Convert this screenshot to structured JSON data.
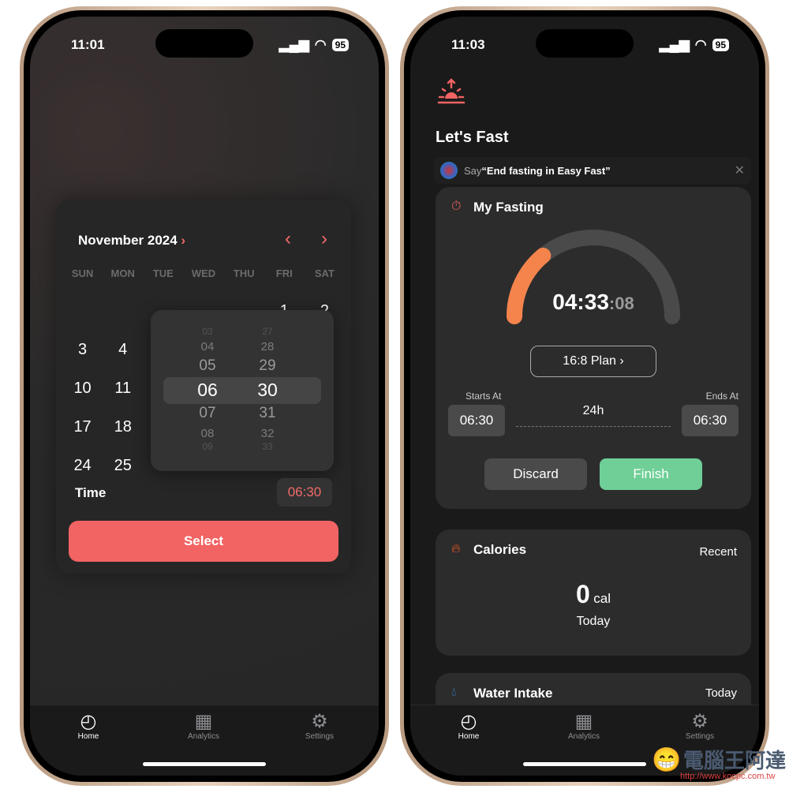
{
  "left_phone": {
    "status": {
      "time": "11:01",
      "battery": "95"
    },
    "calendar": {
      "month_label": "November 2024",
      "weekdays": [
        "SUN",
        "MON",
        "TUE",
        "WED",
        "THU",
        "FRI",
        "SAT"
      ],
      "rows": [
        [
          "",
          "",
          "",
          "",
          "",
          "1",
          "2"
        ],
        [
          "3",
          "4",
          "",
          "",
          "",
          "",
          ""
        ],
        [
          "10",
          "11",
          "",
          "",
          "",
          "",
          ""
        ],
        [
          "17",
          "18",
          "",
          "",
          "",
          "",
          ""
        ],
        [
          "24",
          "25",
          "",
          "",
          "",
          "",
          ""
        ]
      ]
    },
    "picker": {
      "hours": [
        "03",
        "04",
        "05",
        "06",
        "07",
        "08",
        "09"
      ],
      "minutes": [
        "27",
        "28",
        "29",
        "30",
        "31",
        "32",
        "33"
      ],
      "selected_hour": "06",
      "selected_minute": "30"
    },
    "time_label": "Time",
    "time_value": "06:30",
    "select_label": "Select",
    "tabs": [
      {
        "label": "Home",
        "icon": "timer-icon",
        "active": true
      },
      {
        "label": "Analytics",
        "icon": "grid-icon"
      },
      {
        "label": "Settings",
        "icon": "gear-icon"
      }
    ]
  },
  "right_phone": {
    "status": {
      "time": "11:03",
      "battery": "95"
    },
    "title": "Let's Fast",
    "siri": {
      "say": "Say ",
      "phrase": "“End fasting in Easy Fast”"
    },
    "fasting": {
      "title": "My Fasting",
      "elapsed_main": "04:33",
      "elapsed_seconds": ":08",
      "progress": 0.28,
      "plan": "16:8 Plan",
      "starts_label": "Starts At",
      "starts": "06:30",
      "ends_label": "Ends At",
      "ends": "06:30",
      "duration": "24h",
      "discard": "Discard",
      "finish": "Finish"
    },
    "calories": {
      "title": "Calories",
      "link": "Recent",
      "value": "0",
      "unit": "cal",
      "period": "Today"
    },
    "water": {
      "title": "Water Intake",
      "link": "Today"
    },
    "tabs": [
      {
        "label": "Home",
        "icon": "timer-icon",
        "active": true
      },
      {
        "label": "Analytics",
        "icon": "grid-icon"
      },
      {
        "label": "Settings",
        "icon": "gear-icon"
      }
    ]
  },
  "colors": {
    "accent": "#f26363",
    "finish": "#6fcf97",
    "gauge": "#f5844c"
  },
  "watermark": {
    "text": "電腦王阿達",
    "url": "http://www.kocpc.com.tw"
  }
}
